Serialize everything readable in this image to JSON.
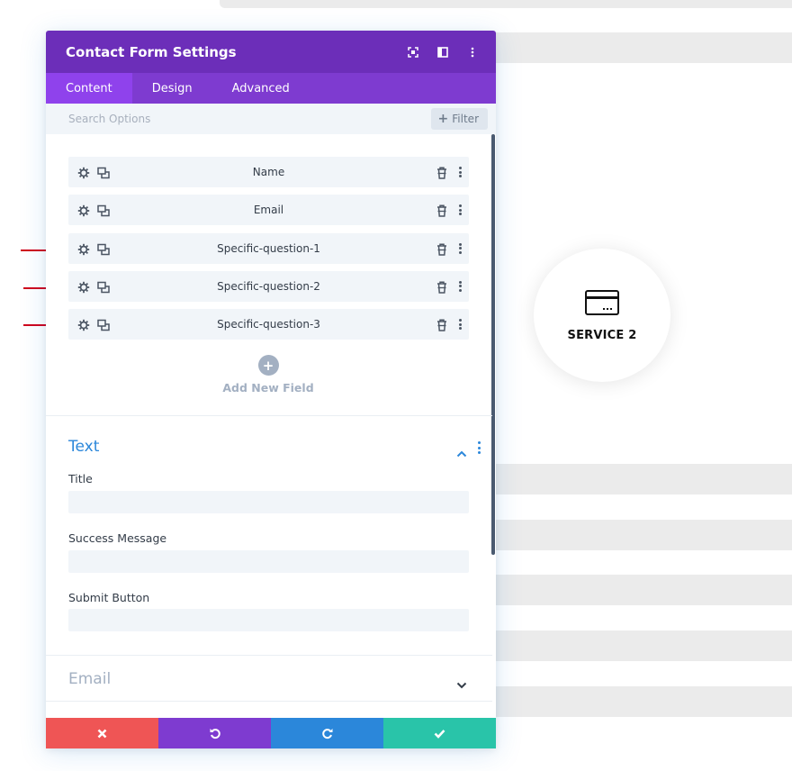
{
  "modal": {
    "title": "Contact Form Settings",
    "header_icons": [
      "screenshot-icon",
      "split-view-icon",
      "more-vertical-icon"
    ],
    "tabs": [
      {
        "label": "Content",
        "active": true
      },
      {
        "label": "Design",
        "active": false
      },
      {
        "label": "Advanced",
        "active": false
      }
    ],
    "search": {
      "placeholder": "Search Options",
      "filter_label": "Filter"
    },
    "fields": [
      {
        "label": "Name"
      },
      {
        "label": "Email"
      },
      {
        "label": "Specific-question-1"
      },
      {
        "label": "Specific-question-2"
      },
      {
        "label": "Specific-question-3"
      }
    ],
    "add_field_label": "Add New Field",
    "sections": {
      "text": {
        "title": "Text",
        "expanded": true,
        "options": {
          "title_label": "Title",
          "title_value": "",
          "success_label": "Success Message",
          "success_value": "",
          "submit_label": "Submit Button",
          "submit_value": ""
        }
      },
      "email": {
        "title": "Email",
        "expanded": false
      }
    },
    "footer_actions": [
      "close-icon",
      "undo-icon",
      "redo-icon",
      "check-icon"
    ]
  },
  "service": {
    "label": "SERVICE 2",
    "icon": "credit-card-icon"
  },
  "colors": {
    "header": "#6c2eb9",
    "tabs": "#7e3bd0",
    "active_tab": "#8f42ec",
    "accent_blue": "#2b87da",
    "cancel": "#ef5555",
    "save": "#29c4a9",
    "arrow": "#d0021b"
  }
}
